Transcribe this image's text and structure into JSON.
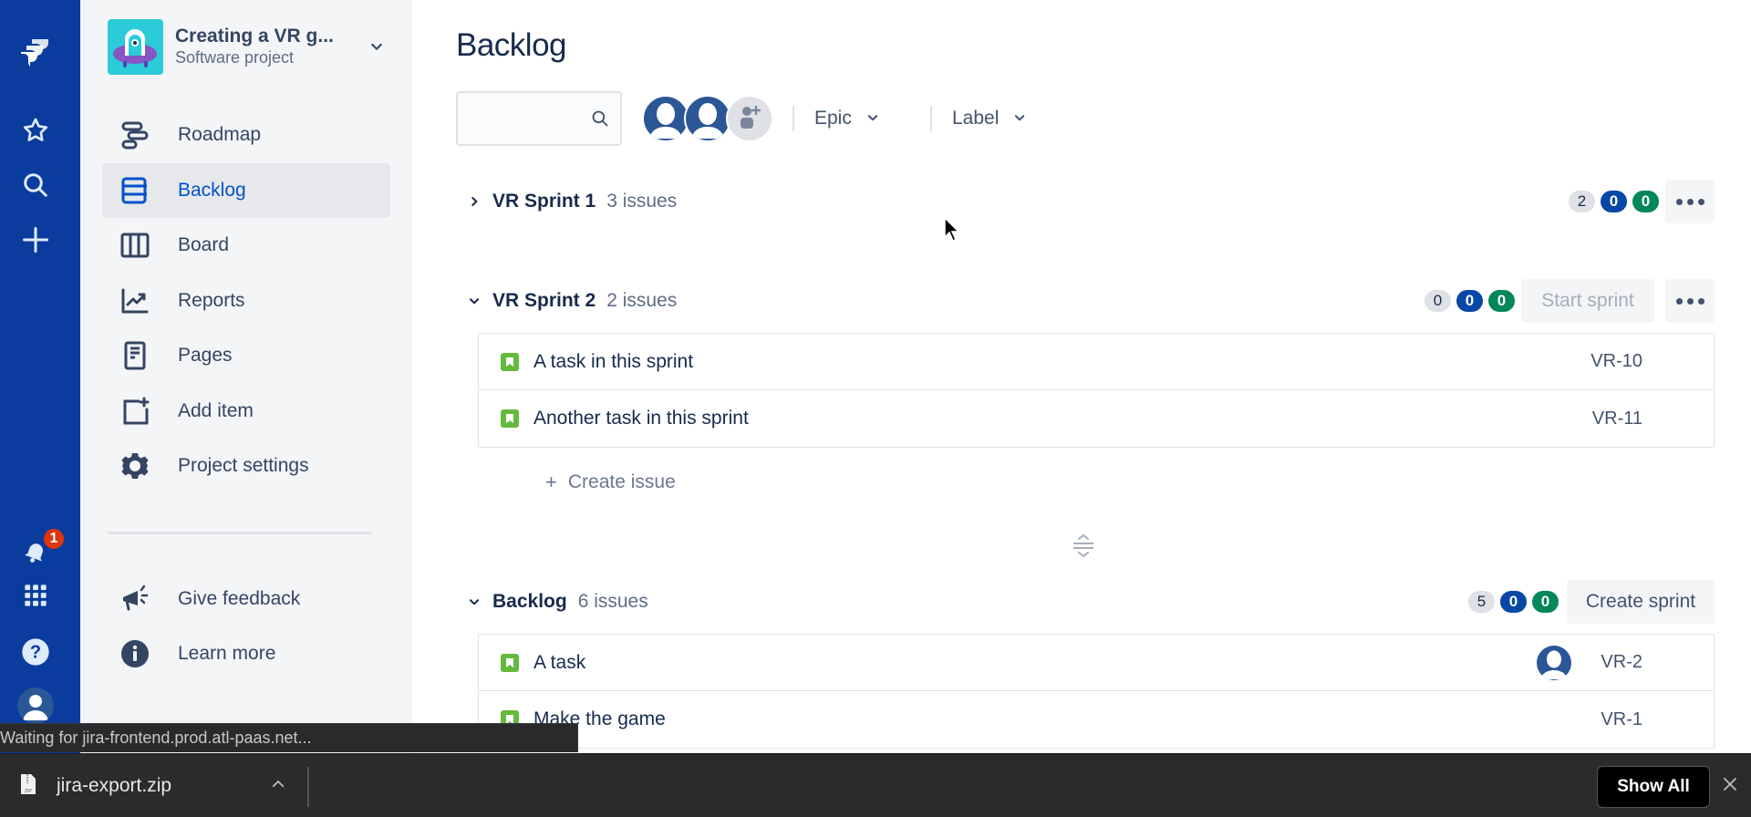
{
  "global_nav": {
    "icons": [
      "jira-logo-icon",
      "star-icon",
      "search-icon",
      "create-plus-icon",
      "notifications-bell-icon",
      "app-switcher-icon",
      "help-icon",
      "profile-avatar-icon"
    ],
    "notification_count": "1",
    "accent_color": "#0A3C9E"
  },
  "project": {
    "name": "Creating a VR g...",
    "type": "Software project"
  },
  "sidebar": {
    "items": [
      {
        "label": "Roadmap",
        "icon": "roadmap-icon"
      },
      {
        "label": "Backlog",
        "icon": "backlog-icon",
        "active": true
      },
      {
        "label": "Board",
        "icon": "board-icon"
      },
      {
        "label": "Reports",
        "icon": "reports-icon"
      },
      {
        "label": "Pages",
        "icon": "pages-icon"
      },
      {
        "label": "Add item",
        "icon": "add-item-icon"
      },
      {
        "label": "Project settings",
        "icon": "gear-icon"
      }
    ],
    "footer": [
      {
        "label": "Give feedback",
        "icon": "megaphone-icon"
      },
      {
        "label": "Learn more",
        "icon": "info-icon"
      }
    ]
  },
  "main": {
    "title": "Backlog",
    "search": {
      "value": "",
      "placeholder": ""
    },
    "filters": {
      "epic": "Epic",
      "label": "Label"
    },
    "sprints": [
      {
        "name": "VR Sprint 1",
        "count": "3 issues",
        "expanded": false,
        "pills": [
          "2",
          "0",
          "0"
        ]
      },
      {
        "name": "VR Sprint 2",
        "count": "2 issues",
        "expanded": true,
        "pills": [
          "0",
          "0",
          "0"
        ],
        "action": "Start sprint",
        "issues": [
          {
            "summary": "A task in this sprint",
            "key": "VR-10"
          },
          {
            "summary": "Another task in this sprint",
            "key": "VR-11"
          }
        ],
        "create_issue": "Create issue"
      }
    ],
    "backlog": {
      "name": "Backlog",
      "count": "6 issues",
      "pills": [
        "5",
        "0",
        "0"
      ],
      "action": "Create sprint",
      "issues": [
        {
          "summary": "A task",
          "key": "VR-2",
          "assignee": true
        },
        {
          "summary": "Make the game",
          "key": "VR-1"
        }
      ]
    },
    "colors": {
      "todo": "#DFE1E6",
      "in_progress": "#0747A6",
      "done": "#00875A",
      "story": "#63BA3C"
    }
  },
  "browser": {
    "status_text": "Waiting for jira-frontend.prod.atl-paas.net...",
    "download_file": "jira-export.zip",
    "show_all": "Show All"
  }
}
